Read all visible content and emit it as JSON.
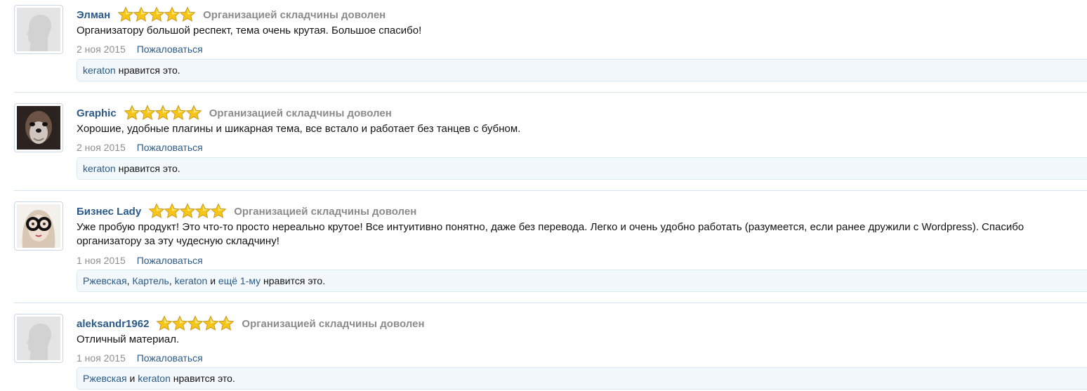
{
  "reviews": [
    {
      "avatar": "default-silhouette",
      "username": "Элман",
      "rating": 5,
      "status": "Организацией складчины доволен",
      "text": "Организатору большой респект, тема очень крутая. Большое спасибо!",
      "date": "2 ноя 2015",
      "report": "Пожаловаться",
      "likes": {
        "users": [
          "keraton"
        ],
        "connector_and": "",
        "more": "",
        "suffix": "нравится это."
      }
    },
    {
      "avatar": "dog-photo",
      "username": "Graphic",
      "rating": 5,
      "status": "Организацией складчины доволен",
      "text": "Хорошие, удобные плагины и шикарная тема, все встало и работает без танцев с бубном.",
      "date": "2 ноя 2015",
      "report": "Пожаловаться",
      "likes": {
        "users": [
          "keraton"
        ],
        "connector_and": "",
        "more": "",
        "suffix": "нравится это."
      }
    },
    {
      "avatar": "woman-glasses-drawing",
      "username": "Бизнес Lady",
      "rating": 5,
      "status": "Организацией складчины доволен",
      "text": "Уже пробую продукт! Это что-то просто нереально крутое! Все интуитивно понятно, даже без перевода. Легко и очень удобно работать (разумеется, если ранее дружили с Wordpress). Спасибо организатору за эту чудесную складчину!",
      "date": "1 ноя 2015",
      "report": "Пожаловаться",
      "likes": {
        "users": [
          "Ржевская",
          "Картель",
          "keraton"
        ],
        "connector_and": "и",
        "more": "ещё 1-му",
        "suffix": "нравится это."
      }
    },
    {
      "avatar": "default-silhouette",
      "username": "aleksandr1962",
      "rating": 5,
      "status": "Организацией складчины доволен",
      "text": "Отличный материал.",
      "date": "1 ноя 2015",
      "report": "Пожаловаться",
      "likes": {
        "users": [
          "Ржевская",
          "keraton"
        ],
        "connector_and": "и",
        "more": "",
        "suffix": "нравится это."
      }
    }
  ],
  "colors": {
    "link": "#2b5a87",
    "status_gray": "#8b8b8b",
    "likes_bg": "#f2f8fc",
    "separator": "#d9e3ec",
    "star_fill": "#f5c518"
  }
}
